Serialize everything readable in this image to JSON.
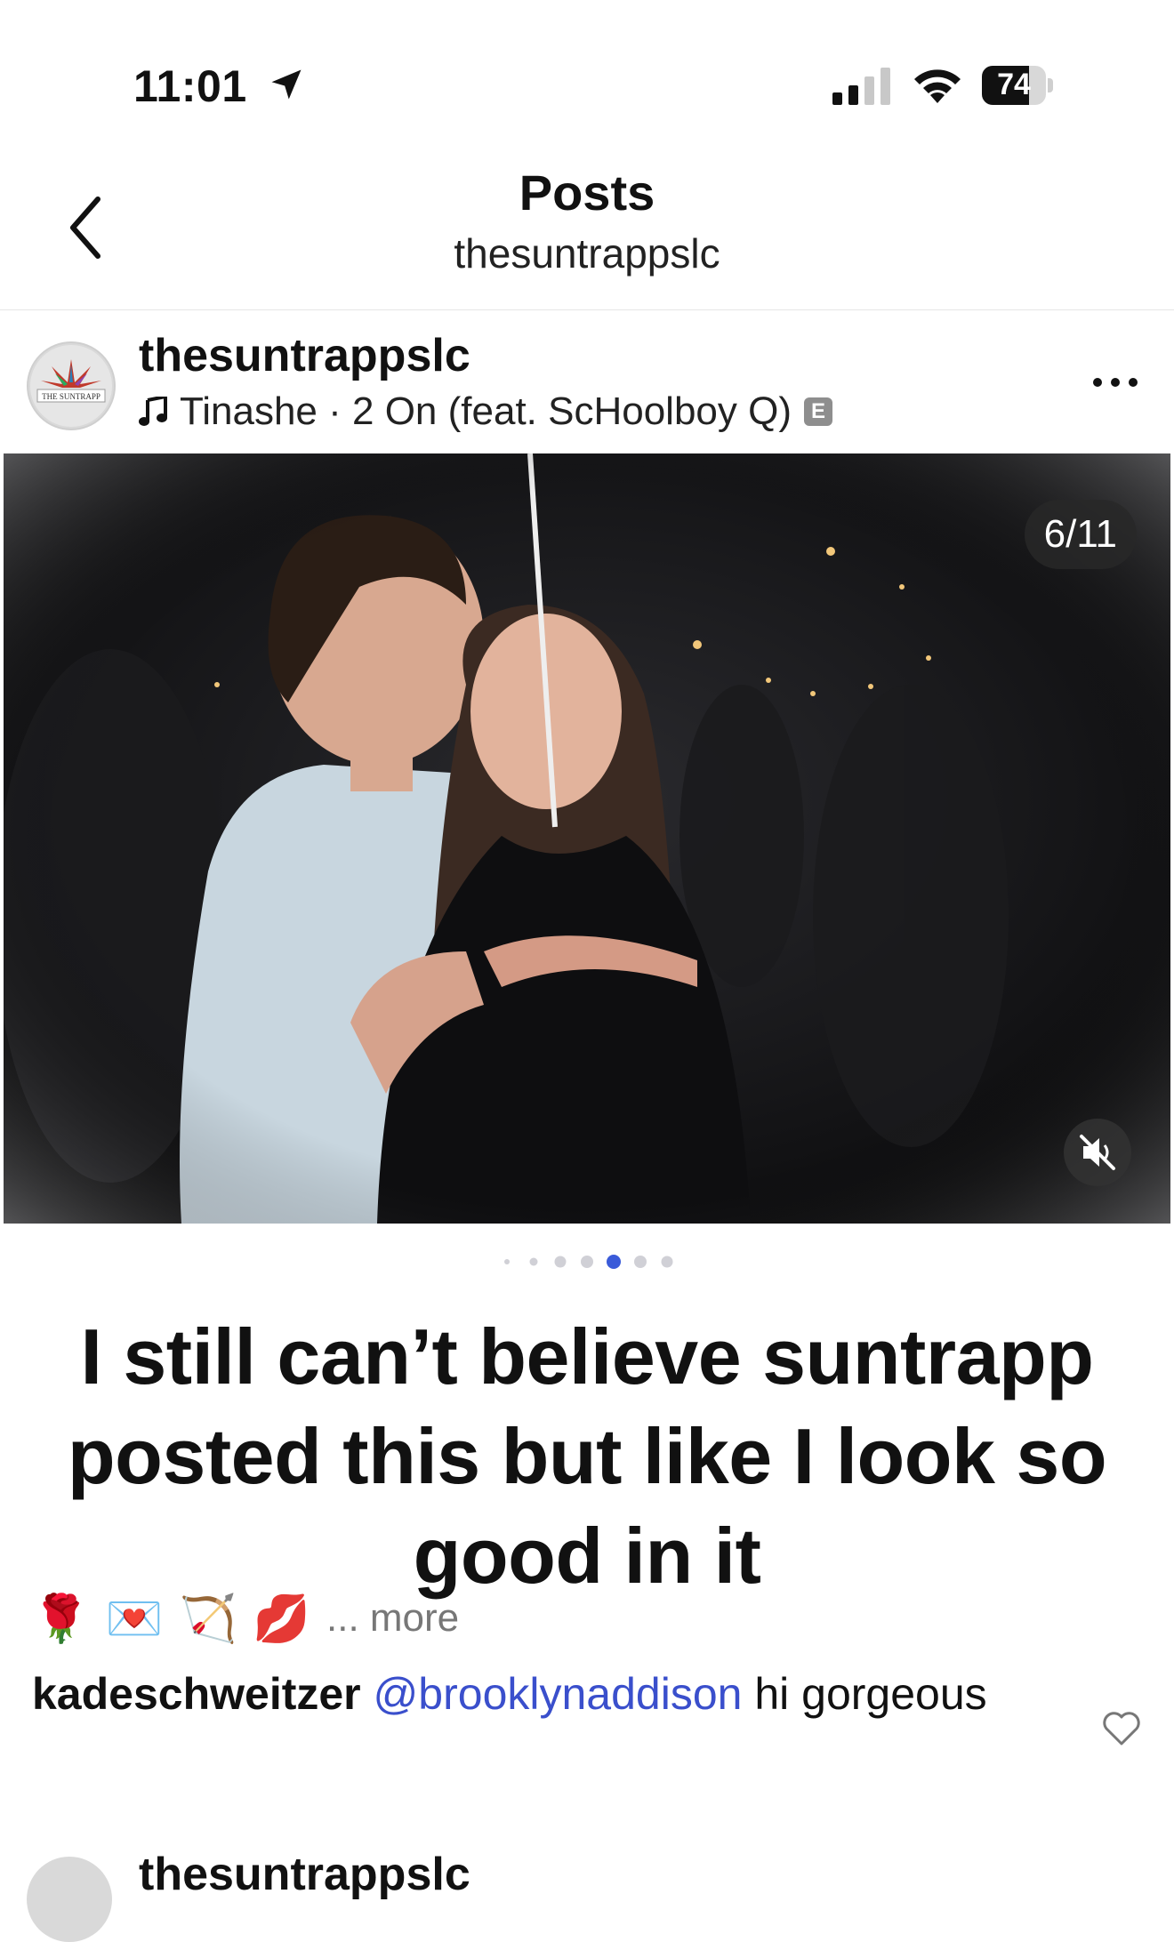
{
  "status_bar": {
    "time": "11:01",
    "battery_percent": "74",
    "battery_level": 0.74
  },
  "nav": {
    "title": "Posts",
    "subtitle": "thesuntrappslc"
  },
  "post": {
    "username": "thesuntrappslc",
    "song": "Tinashe · 2 On (feat. ScHoolboy Q)",
    "explicit_badge": "E",
    "avatar_text": "THE SUNTRAPP",
    "slide_counter": "6/11",
    "carousel": {
      "total_dots": 7,
      "active_index": 4,
      "accent": "#3a5bd9"
    },
    "overlay_text": "I still can’t believe suntrapp posted this but like I look so good in it",
    "caption": {
      "emojis": [
        "🌹",
        "💌",
        "🏹",
        "💋"
      ],
      "more": "... more"
    },
    "comment": {
      "user": "kadeschweitzer",
      "mention": "@brooklynaddison",
      "text": " hi gorgeous"
    },
    "next_post_username": "thesuntrappslc"
  },
  "icons": {
    "back": "chevron-left-icon",
    "location": "location-arrow-icon",
    "more": "more-dots-icon",
    "mute": "speaker-muted-icon",
    "heart": "heart-outline-icon",
    "music": "music-note-icon"
  }
}
